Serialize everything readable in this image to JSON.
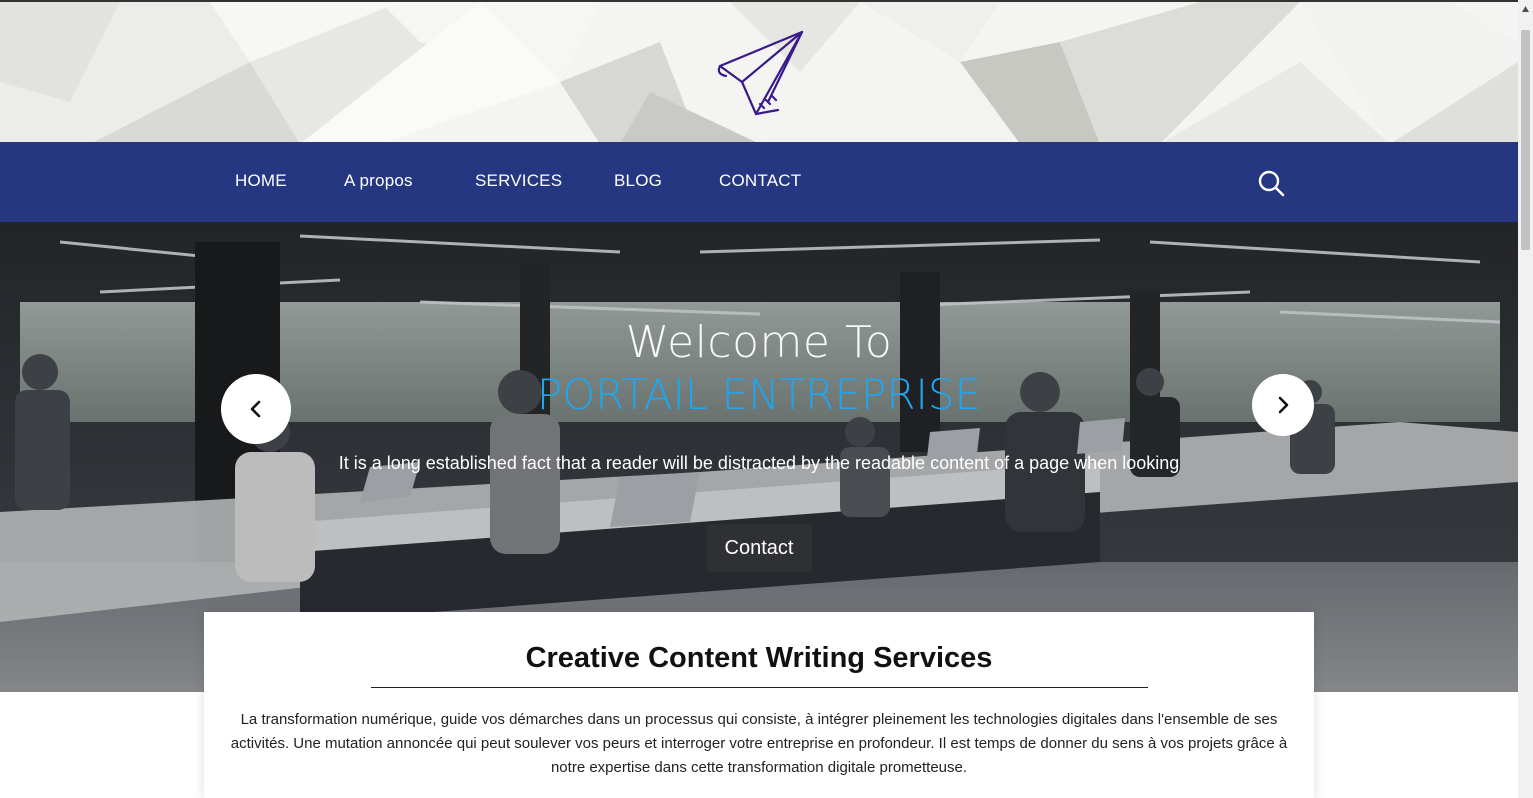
{
  "header": {
    "logo_icon": "paper-plane-icon"
  },
  "nav": {
    "items": [
      {
        "label": "HOME"
      },
      {
        "label": "A propos"
      },
      {
        "label": "SERVICES"
      },
      {
        "label": "BLOG"
      },
      {
        "label": "CONTACT"
      }
    ],
    "search_icon": "search-icon"
  },
  "hero": {
    "title_line1": "Welcome To",
    "title_line2": "PORTAIL ENTREPRISE",
    "text": "It is a long established fact that a reader will be distracted by the readable content of a page when looking",
    "button_label": "Contact",
    "prev_icon": "chevron-left-icon",
    "next_icon": "chevron-right-icon",
    "accent_color": "#1ea7f0"
  },
  "card": {
    "title": "Creative Content Writing Services",
    "text": "La transformation numérique, guide vos démarches dans un processus qui consiste, à intégrer pleinement les technologies digitales dans l'ensemble de ses activités. Une mutation annoncée qui peut soulever vos peurs et interroger votre entreprise en profondeur. Il est temps de donner du sens à vos projets grâce à notre expertise dans cette transformation digitale prometteuse."
  },
  "colors": {
    "nav_bg": "#253780",
    "button_bg": "#2e3034",
    "logo_stroke": "#3a1a8a"
  }
}
